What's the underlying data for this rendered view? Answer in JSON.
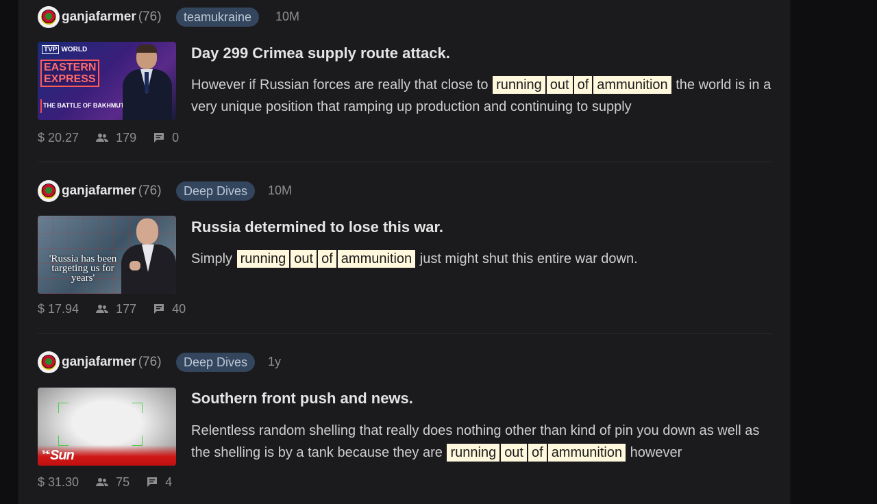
{
  "posts": [
    {
      "author": "ganjafarmer",
      "reputation": "(76)",
      "community": "teamukraine",
      "age": "10M",
      "title": "Day 299 Crimea supply route attack.",
      "snippet_before": "However if Russian forces are really that close to",
      "highlights": [
        "running",
        "out",
        "of",
        "ammunition"
      ],
      "snippet_after": "the world is in a very unique position that ramping up production and continuing to supply",
      "thumbnail": {
        "logo_tv": "TVP",
        "logo_world": "WORLD",
        "headline_1": "EASTERN",
        "headline_2": "EXPRESS",
        "subtitle": "THE BATTLE OF BAKHMUT"
      },
      "payout": "$ 20.27",
      "votes": "179",
      "comments": "0"
    },
    {
      "author": "ganjafarmer",
      "reputation": "(76)",
      "community": "Deep Dives",
      "age": "10M",
      "title": "Russia determined to lose this war.",
      "snippet_before": "Simply",
      "highlights": [
        "running",
        "out",
        "of",
        "ammunition"
      ],
      "snippet_after": "just might shut this entire war down.",
      "thumbnail": {
        "quote": "'Russia has been targeting us for years'"
      },
      "payout": "$ 17.94",
      "votes": "177",
      "comments": "40"
    },
    {
      "author": "ganjafarmer",
      "reputation": "(76)",
      "community": "Deep Dives",
      "age": "1y",
      "title": "Southern front push and news.",
      "snippet_before": "Relentless random shelling that really does nothing other than kind of pin you down as well as the shelling is by a tank because they are",
      "highlights": [
        "running",
        "out",
        "of",
        "ammunition"
      ],
      "snippet_after": "however",
      "thumbnail": {
        "brand_small": "THE",
        "brand": "Sun"
      },
      "payout": "$ 31.30",
      "votes": "75",
      "comments": "4"
    }
  ],
  "colors": {
    "background": "#1b1b1e",
    "highlight": "#fff8dc",
    "community_pill": "#34465d"
  },
  "icons": {
    "avatar": "avatar-icon",
    "votes": "people-icon",
    "comments": "comment-icon"
  }
}
